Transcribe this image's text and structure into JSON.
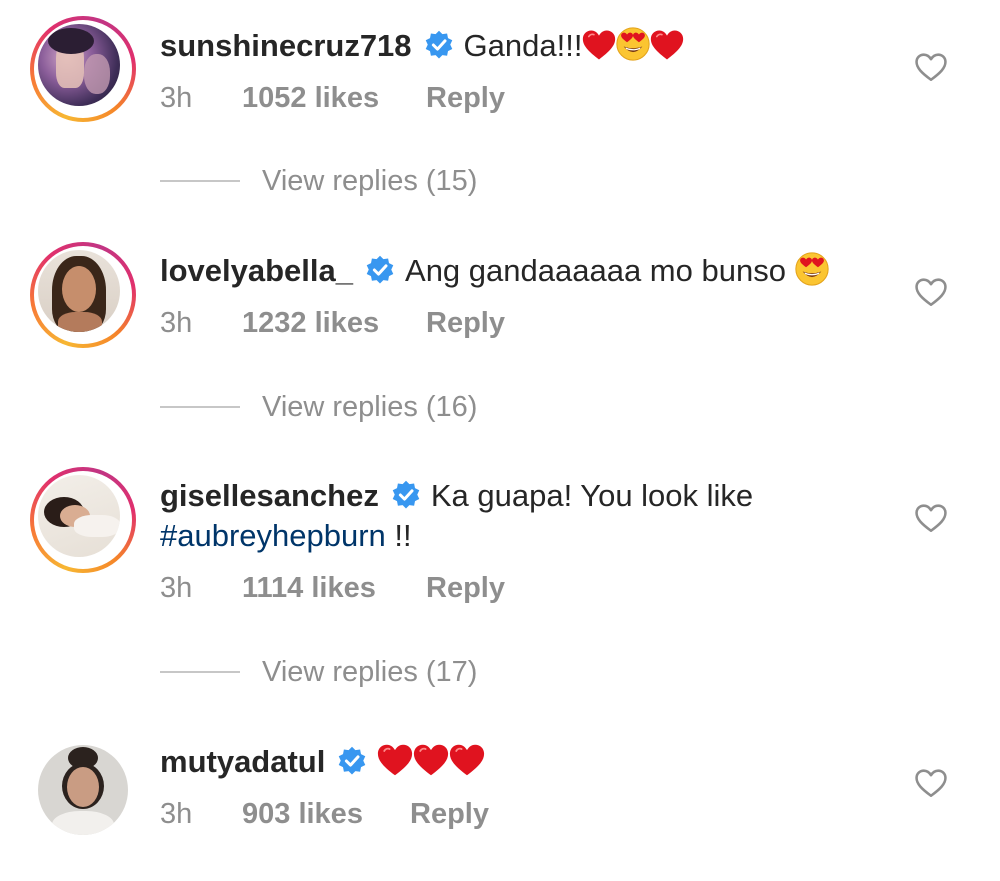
{
  "comments": [
    {
      "username": "sunshinecruz718",
      "text": "Ganda!!!",
      "emojis": [
        "red-heart",
        "heart-eyes",
        "red-heart"
      ],
      "time": "3h",
      "likes": "1052 likes",
      "reply_label": "Reply",
      "view_replies": "View replies (15)"
    },
    {
      "username": "lovelyabella_",
      "text": "Ang gandaaaaaa mo bunso",
      "emojis": [
        "heart-eyes"
      ],
      "time": "3h",
      "likes": "1232 likes",
      "reply_label": "Reply",
      "view_replies": "View replies (16)"
    },
    {
      "username": "gisellesanchez",
      "text": "Ka guapa! You look like",
      "hashtag": "#aubreyhepburn",
      "text_after": " !!",
      "time": "3h",
      "likes": "1114 likes",
      "reply_label": "Reply",
      "view_replies": "View replies (17)"
    },
    {
      "username": "mutyadatul",
      "text": "",
      "emojis": [
        "red-heart",
        "red-heart",
        "red-heart"
      ],
      "time": "3h",
      "likes": "903 likes",
      "reply_label": "Reply"
    }
  ],
  "colors": {
    "username": "#262626",
    "meta": "#8e8e8e",
    "hashtag": "#003569",
    "verified": "#3897f0",
    "heart": "#ed4956"
  }
}
